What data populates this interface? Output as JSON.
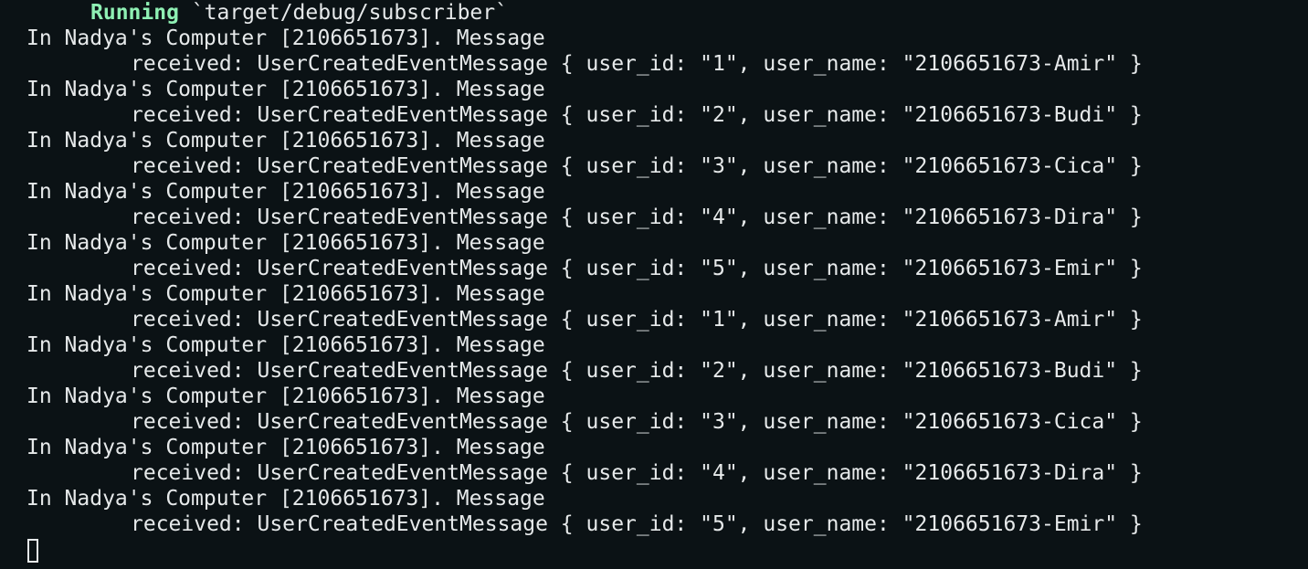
{
  "running": {
    "label": "Running",
    "command": " `target/debug/subscriber`"
  },
  "log": [
    {
      "prefix": "In Nadya's Computer [2106651673]. Message",
      "body": "received: UserCreatedEventMessage { user_id: \"1\", user_name: \"2106651673-Amir\" }"
    },
    {
      "prefix": "In Nadya's Computer [2106651673]. Message",
      "body": "received: UserCreatedEventMessage { user_id: \"2\", user_name: \"2106651673-Budi\" }"
    },
    {
      "prefix": "In Nadya's Computer [2106651673]. Message",
      "body": "received: UserCreatedEventMessage { user_id: \"3\", user_name: \"2106651673-Cica\" }"
    },
    {
      "prefix": "In Nadya's Computer [2106651673]. Message",
      "body": "received: UserCreatedEventMessage { user_id: \"4\", user_name: \"2106651673-Dira\" }"
    },
    {
      "prefix": "In Nadya's Computer [2106651673]. Message",
      "body": "received: UserCreatedEventMessage { user_id: \"5\", user_name: \"2106651673-Emir\" }"
    },
    {
      "prefix": "In Nadya's Computer [2106651673]. Message",
      "body": "received: UserCreatedEventMessage { user_id: \"1\", user_name: \"2106651673-Amir\" }"
    },
    {
      "prefix": "In Nadya's Computer [2106651673]. Message",
      "body": "received: UserCreatedEventMessage { user_id: \"2\", user_name: \"2106651673-Budi\" }"
    },
    {
      "prefix": "In Nadya's Computer [2106651673]. Message",
      "body": "received: UserCreatedEventMessage { user_id: \"3\", user_name: \"2106651673-Cica\" }"
    },
    {
      "prefix": "In Nadya's Computer [2106651673]. Message",
      "body": "received: UserCreatedEventMessage { user_id: \"4\", user_name: \"2106651673-Dira\" }"
    },
    {
      "prefix": "In Nadya's Computer [2106651673]. Message",
      "body": "received: UserCreatedEventMessage { user_id: \"5\", user_name: \"2106651673-Emir\" }"
    }
  ],
  "colors": {
    "background": "#0b1215",
    "text": "#e6e9ea",
    "running_accent": "#8ff0b4"
  }
}
